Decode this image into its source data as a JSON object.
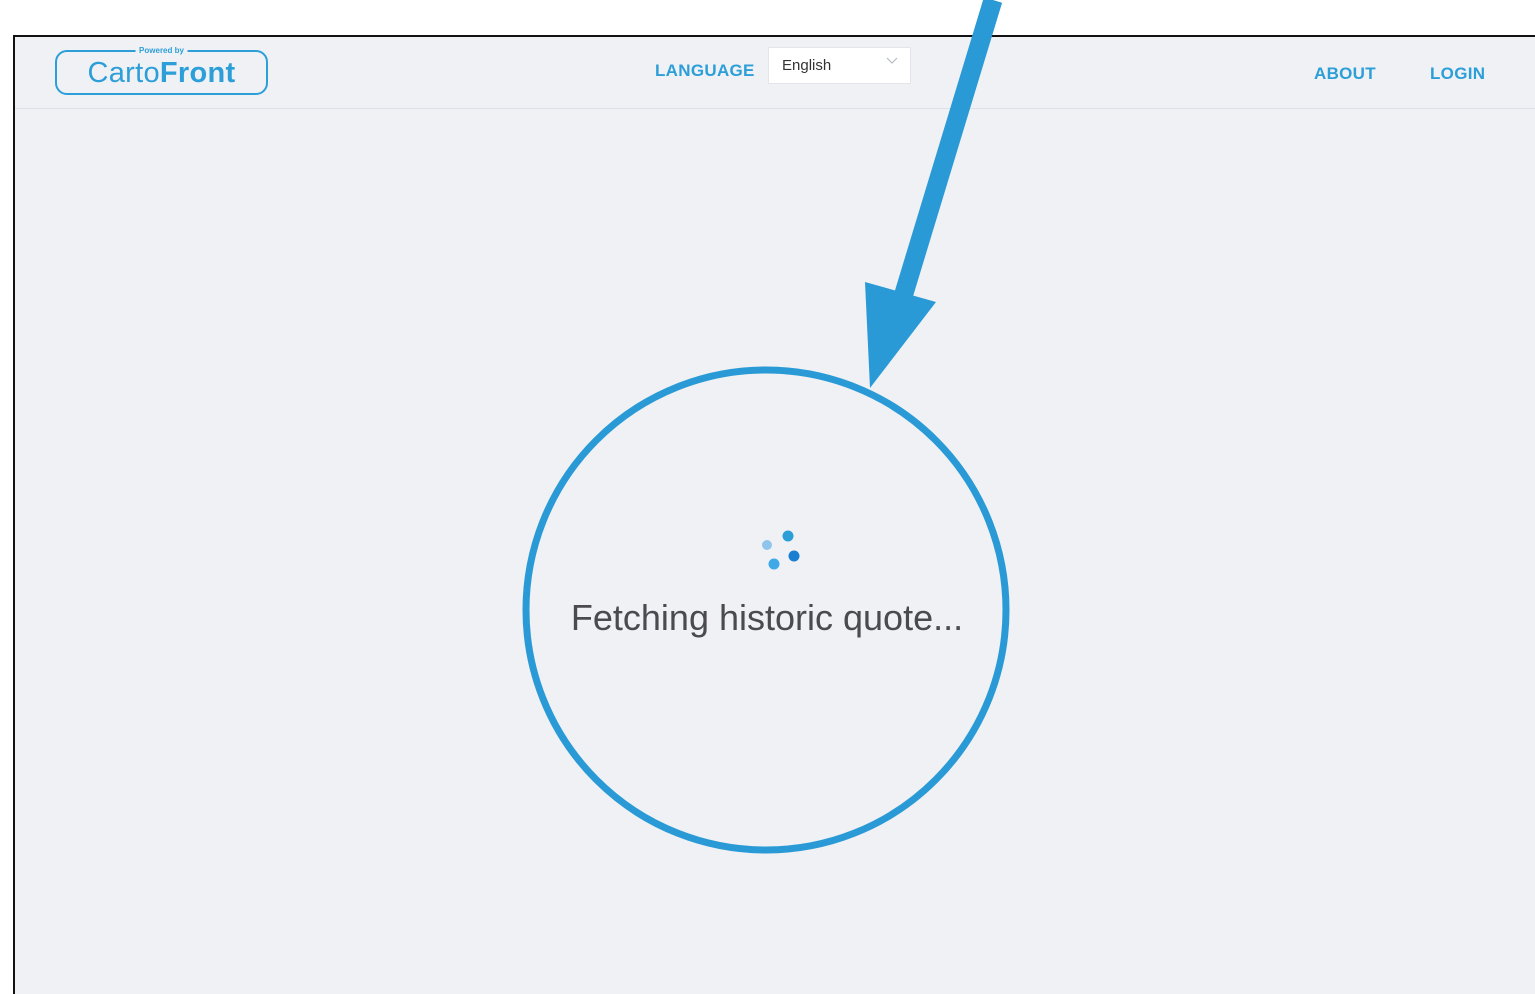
{
  "header": {
    "logo": {
      "powered_by": "Powered by",
      "brand_prefix": "Carto",
      "brand_suffix": "Front"
    },
    "language": {
      "label": "LANGUAGE",
      "selected": "English"
    },
    "nav": {
      "about": "ABOUT",
      "login": "LOGIN"
    }
  },
  "main": {
    "spinner_icon": "loading-dots-icon",
    "loading_text": "Fetching historic quote..."
  },
  "colors": {
    "accent": "#2c9ed8",
    "background": "#eff1f5",
    "text": "#4a4a4f",
    "annotation": "#2a9ad6"
  }
}
